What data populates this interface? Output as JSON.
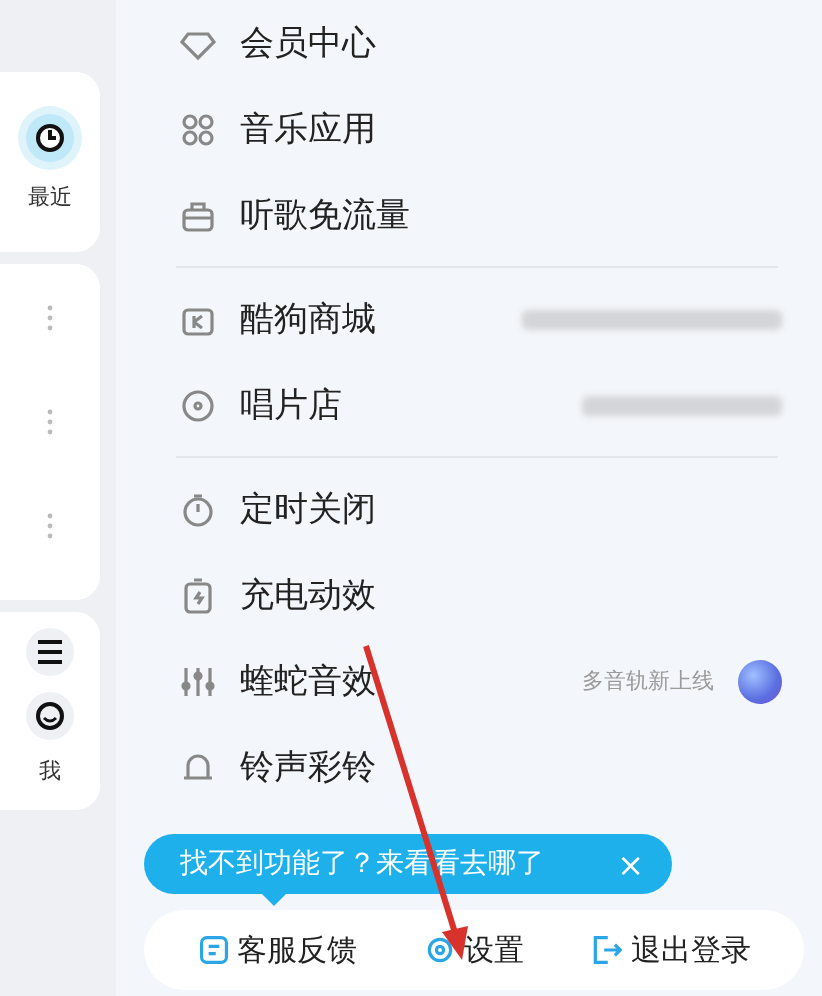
{
  "sidebar": {
    "items": [
      {
        "kind": "clock",
        "label": "最近",
        "selected": true
      },
      {
        "kind": "dots"
      },
      {
        "kind": "dots"
      },
      {
        "kind": "dots"
      },
      {
        "kind": "list",
        "selected": false
      },
      {
        "kind": "face",
        "label": "我",
        "selected": false
      }
    ]
  },
  "menu": {
    "groups": [
      [
        {
          "kind": "diamond",
          "label": "会员中心"
        },
        {
          "kind": "grid",
          "label": "音乐应用"
        },
        {
          "kind": "bag",
          "label": "听歌免流量"
        }
      ],
      [
        {
          "kind": "shop",
          "label": "酷狗商城",
          "blurred": true
        },
        {
          "kind": "disc",
          "label": "唱片店",
          "blurred": true
        }
      ],
      [
        {
          "kind": "timer",
          "label": "定时关闭"
        },
        {
          "kind": "battery",
          "label": "充电动效"
        },
        {
          "kind": "sliders",
          "label": "蝰蛇音效",
          "note": "多音轨新上线",
          "badge": true
        },
        {
          "kind": "bell",
          "label": "铃声彩铃"
        }
      ]
    ]
  },
  "tooltip": {
    "text": "找不到功能了？来看看去哪了",
    "close": "×"
  },
  "bottom_bar": [
    {
      "kind": "feedback",
      "label": "客服反馈"
    },
    {
      "kind": "gear",
      "label": "设置"
    },
    {
      "kind": "exit",
      "label": "退出登录"
    }
  ]
}
